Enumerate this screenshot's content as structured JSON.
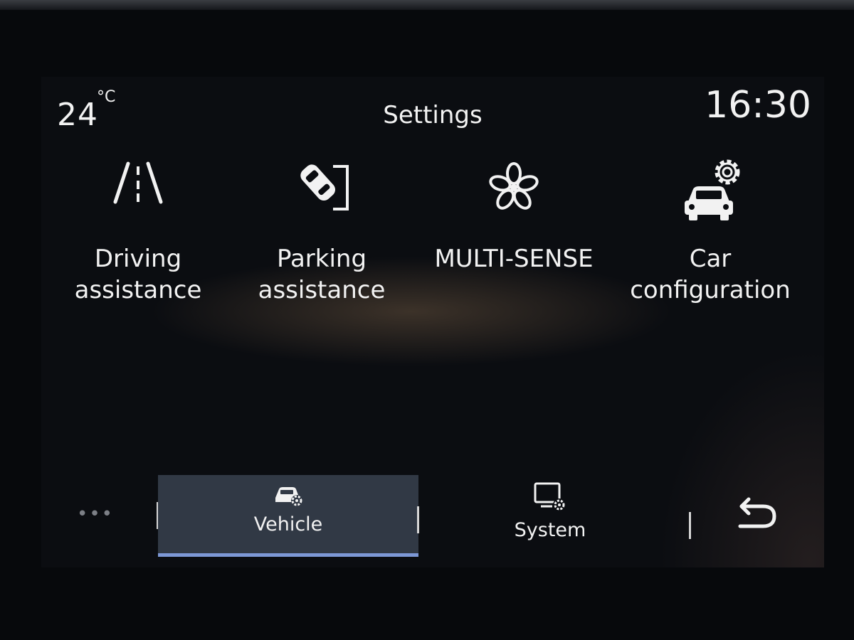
{
  "status": {
    "temperature": "24",
    "temperature_unit": "°C",
    "title": "Settings",
    "time": "16:30"
  },
  "tiles": [
    {
      "label": "Driving\nassistance",
      "icon": "lane-icon"
    },
    {
      "label": "Parking\nassistance",
      "icon": "parking-car-icon"
    },
    {
      "label": "MULTI-SENSE",
      "icon": "flower-icon"
    },
    {
      "label": "Car\nconfiguration",
      "icon": "car-gear-icon"
    }
  ],
  "bottom_nav": {
    "more": "•••",
    "tabs": [
      {
        "label": "Vehicle",
        "icon": "car-gear-icon",
        "active": true
      },
      {
        "label": "System",
        "icon": "screen-gear-icon",
        "active": false
      }
    ],
    "back_icon": "back-arrow-icon"
  },
  "colors": {
    "background": "#0b0d11",
    "text": "#f2f2f2",
    "active_tab": "#313945",
    "active_underline": "#7d98d6"
  }
}
